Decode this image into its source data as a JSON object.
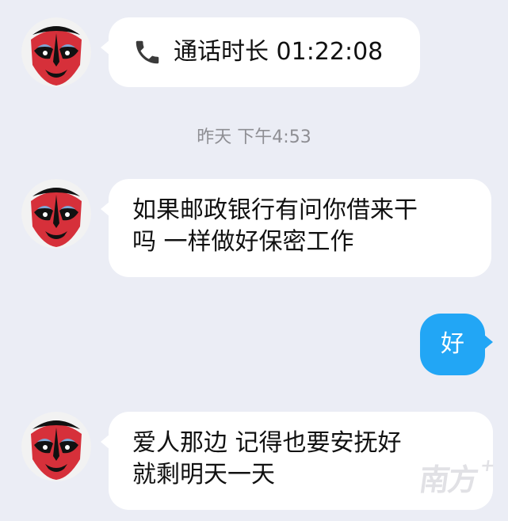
{
  "messages": [
    {
      "id": "call",
      "direction": "incoming",
      "type": "call-record",
      "icon": "phone-icon",
      "text": "通话时长 01:22:08"
    },
    {
      "id": "m1",
      "direction": "incoming",
      "lines": [
        "如果邮政银行有问你借来干",
        "吗 一样做好保密工作"
      ]
    },
    {
      "id": "m2",
      "direction": "outgoing",
      "text": "好"
    },
    {
      "id": "m3",
      "direction": "incoming",
      "lines": [
        "爱人那边 记得也要安抚好",
        "就剩明天一天"
      ]
    }
  ],
  "timestamp": "昨天 下午4:53",
  "watermark": {
    "text": "南方",
    "mark": "+"
  },
  "colors": {
    "background": "#ebedf5",
    "incoming_bubble": "#ffffff",
    "outgoing_bubble": "#22a6f5",
    "timestamp_text": "#8e8e93"
  }
}
